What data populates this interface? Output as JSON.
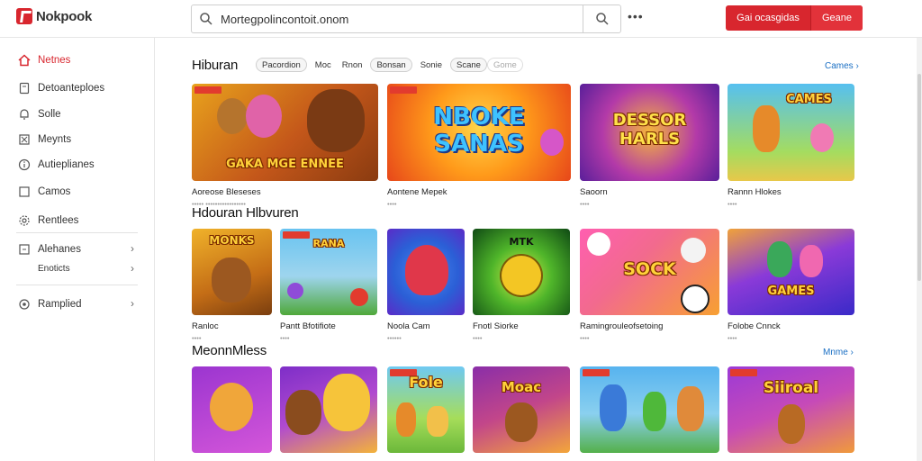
{
  "app": {
    "logo_text": "Nokpook"
  },
  "search": {
    "value": "Mortegpolincontoit.onom"
  },
  "header": {
    "more": "•••",
    "cta_primary": "Gai ocasgidas",
    "cta_secondary": "Geane"
  },
  "sidebar": {
    "items": [
      {
        "label": "Netnes",
        "icon": "home-icon",
        "active": true
      },
      {
        "label": "Detoanteploes",
        "icon": "bookmark-icon"
      },
      {
        "label": "Solle",
        "icon": "bell-icon"
      },
      {
        "label": "Meynts",
        "icon": "grid-icon"
      },
      {
        "label": "Autieplianes",
        "icon": "info-icon"
      },
      {
        "label": "Camos",
        "icon": "square-icon"
      },
      {
        "label": "Rentlees",
        "icon": "settings-icon"
      },
      {
        "label": "Alehanes",
        "icon": "flag-icon"
      },
      {
        "label": "Enoticts",
        "icon": ""
      },
      {
        "label": "Ramplied",
        "icon": "gear-icon"
      }
    ]
  },
  "sections": [
    {
      "title": "Hiburan",
      "chips": [
        "Pacordion",
        "Moc",
        "Rnon",
        "Bonsan",
        "Sonie",
        "Scane",
        "Gome"
      ],
      "more": "Cames ›",
      "cards": [
        {
          "title": "Aoreose Bleseses",
          "meta": "••••• •••••••••••••••••",
          "art": "GAKA MGE ENNEE",
          "colors": [
            "#e8a21c",
            "#8a3b10"
          ]
        },
        {
          "title": "Aontene Mepek",
          "meta": "••••",
          "art": "NBOKE SANAS",
          "colors": [
            "#ffb000",
            "#e74a14"
          ]
        },
        {
          "title": "Saoorn",
          "meta": "••••",
          "art": "DESSOR HARLS",
          "colors": [
            "#7a2bb8",
            "#e5539b"
          ]
        },
        {
          "title": "Rannn Hlokes",
          "meta": "••••",
          "art": "CAMES",
          "colors": [
            "#56c0f0",
            "#9bd14a"
          ]
        }
      ]
    },
    {
      "title": "Hdouran Hlbvuren",
      "cards": [
        {
          "title": "Ranloc",
          "meta": "••••",
          "art": "MONKS",
          "colors": [
            "#e89b1e",
            "#7a3e0f"
          ]
        },
        {
          "title": "Pantt Bfotifiote",
          "meta": "••••",
          "art": "RANA",
          "colors": [
            "#68c3f0",
            "#4fa83a"
          ]
        },
        {
          "title": "Noola Cam",
          "meta": "••••••",
          "art": "",
          "colors": [
            "#2b5fd6",
            "#7d3be0"
          ]
        },
        {
          "title": "Fnotl Siorke",
          "meta": "••••",
          "art": "MTK",
          "colors": [
            "#1f7a22",
            "#9ae03a"
          ]
        },
        {
          "title": "Ramingrouleofsetoing",
          "meta": "••••",
          "art": "SOCK",
          "colors": [
            "#ff5fb0",
            "#f7a032"
          ]
        },
        {
          "title": "Folobe Cnnck",
          "meta": "••••",
          "art": "GAMES",
          "colors": [
            "#4a3ad8",
            "#f0a23a"
          ]
        }
      ]
    },
    {
      "title": "MeonnMless",
      "more": "Mnme ›",
      "cards": [
        {
          "colors": [
            "#9b35d0",
            "#d456d9"
          ],
          "art": ""
        },
        {
          "colors": [
            "#7e2ec8",
            "#f3b33a"
          ],
          "art": ""
        },
        {
          "colors": [
            "#6fc9f2",
            "#6bb83a"
          ],
          "art": "Fole"
        },
        {
          "colors": [
            "#8a2ea8",
            "#f3a63a"
          ],
          "art": "Moac"
        },
        {
          "colors": [
            "#57b3ef",
            "#54b04a"
          ],
          "art": ""
        },
        {
          "colors": [
            "#9c3ad6",
            "#f09a3b"
          ],
          "art": "Siiroal"
        }
      ]
    }
  ]
}
